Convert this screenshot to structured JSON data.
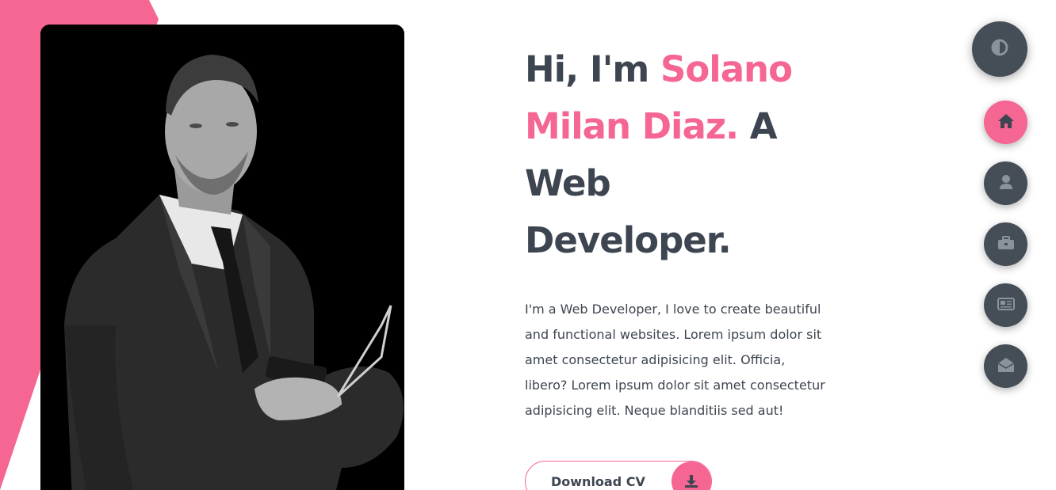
{
  "hero": {
    "greeting": "Hi, I'm ",
    "name_line1": "Solano",
    "name_line2": "Milan Diaz.",
    "role_a": " A",
    "role_line3": "Web",
    "role_line4": "Developer.",
    "description": "I'm a Web Developer, I love to create beautiful and functional websites. Lorem ipsum dolor sit amet consectetur adipisicing elit. Officia, libero? Lorem ipsum dolor sit amet consectetur adipisicing elit. Neque blanditiis sed aut!"
  },
  "cta": {
    "label": "Download CV",
    "icon": "download-icon"
  },
  "nav": {
    "theme_toggle_icon": "contrast-icon",
    "items": [
      {
        "icon": "home-icon",
        "active": true
      },
      {
        "icon": "user-icon",
        "active": false
      },
      {
        "icon": "briefcase-icon",
        "active": false
      },
      {
        "icon": "newspaper-icon",
        "active": false
      },
      {
        "icon": "envelope-open-icon",
        "active": false
      }
    ]
  },
  "colors": {
    "accent": "#f56692",
    "dark": "#3d4550",
    "button_dark": "#454e56",
    "icon_muted": "#8a939b"
  }
}
